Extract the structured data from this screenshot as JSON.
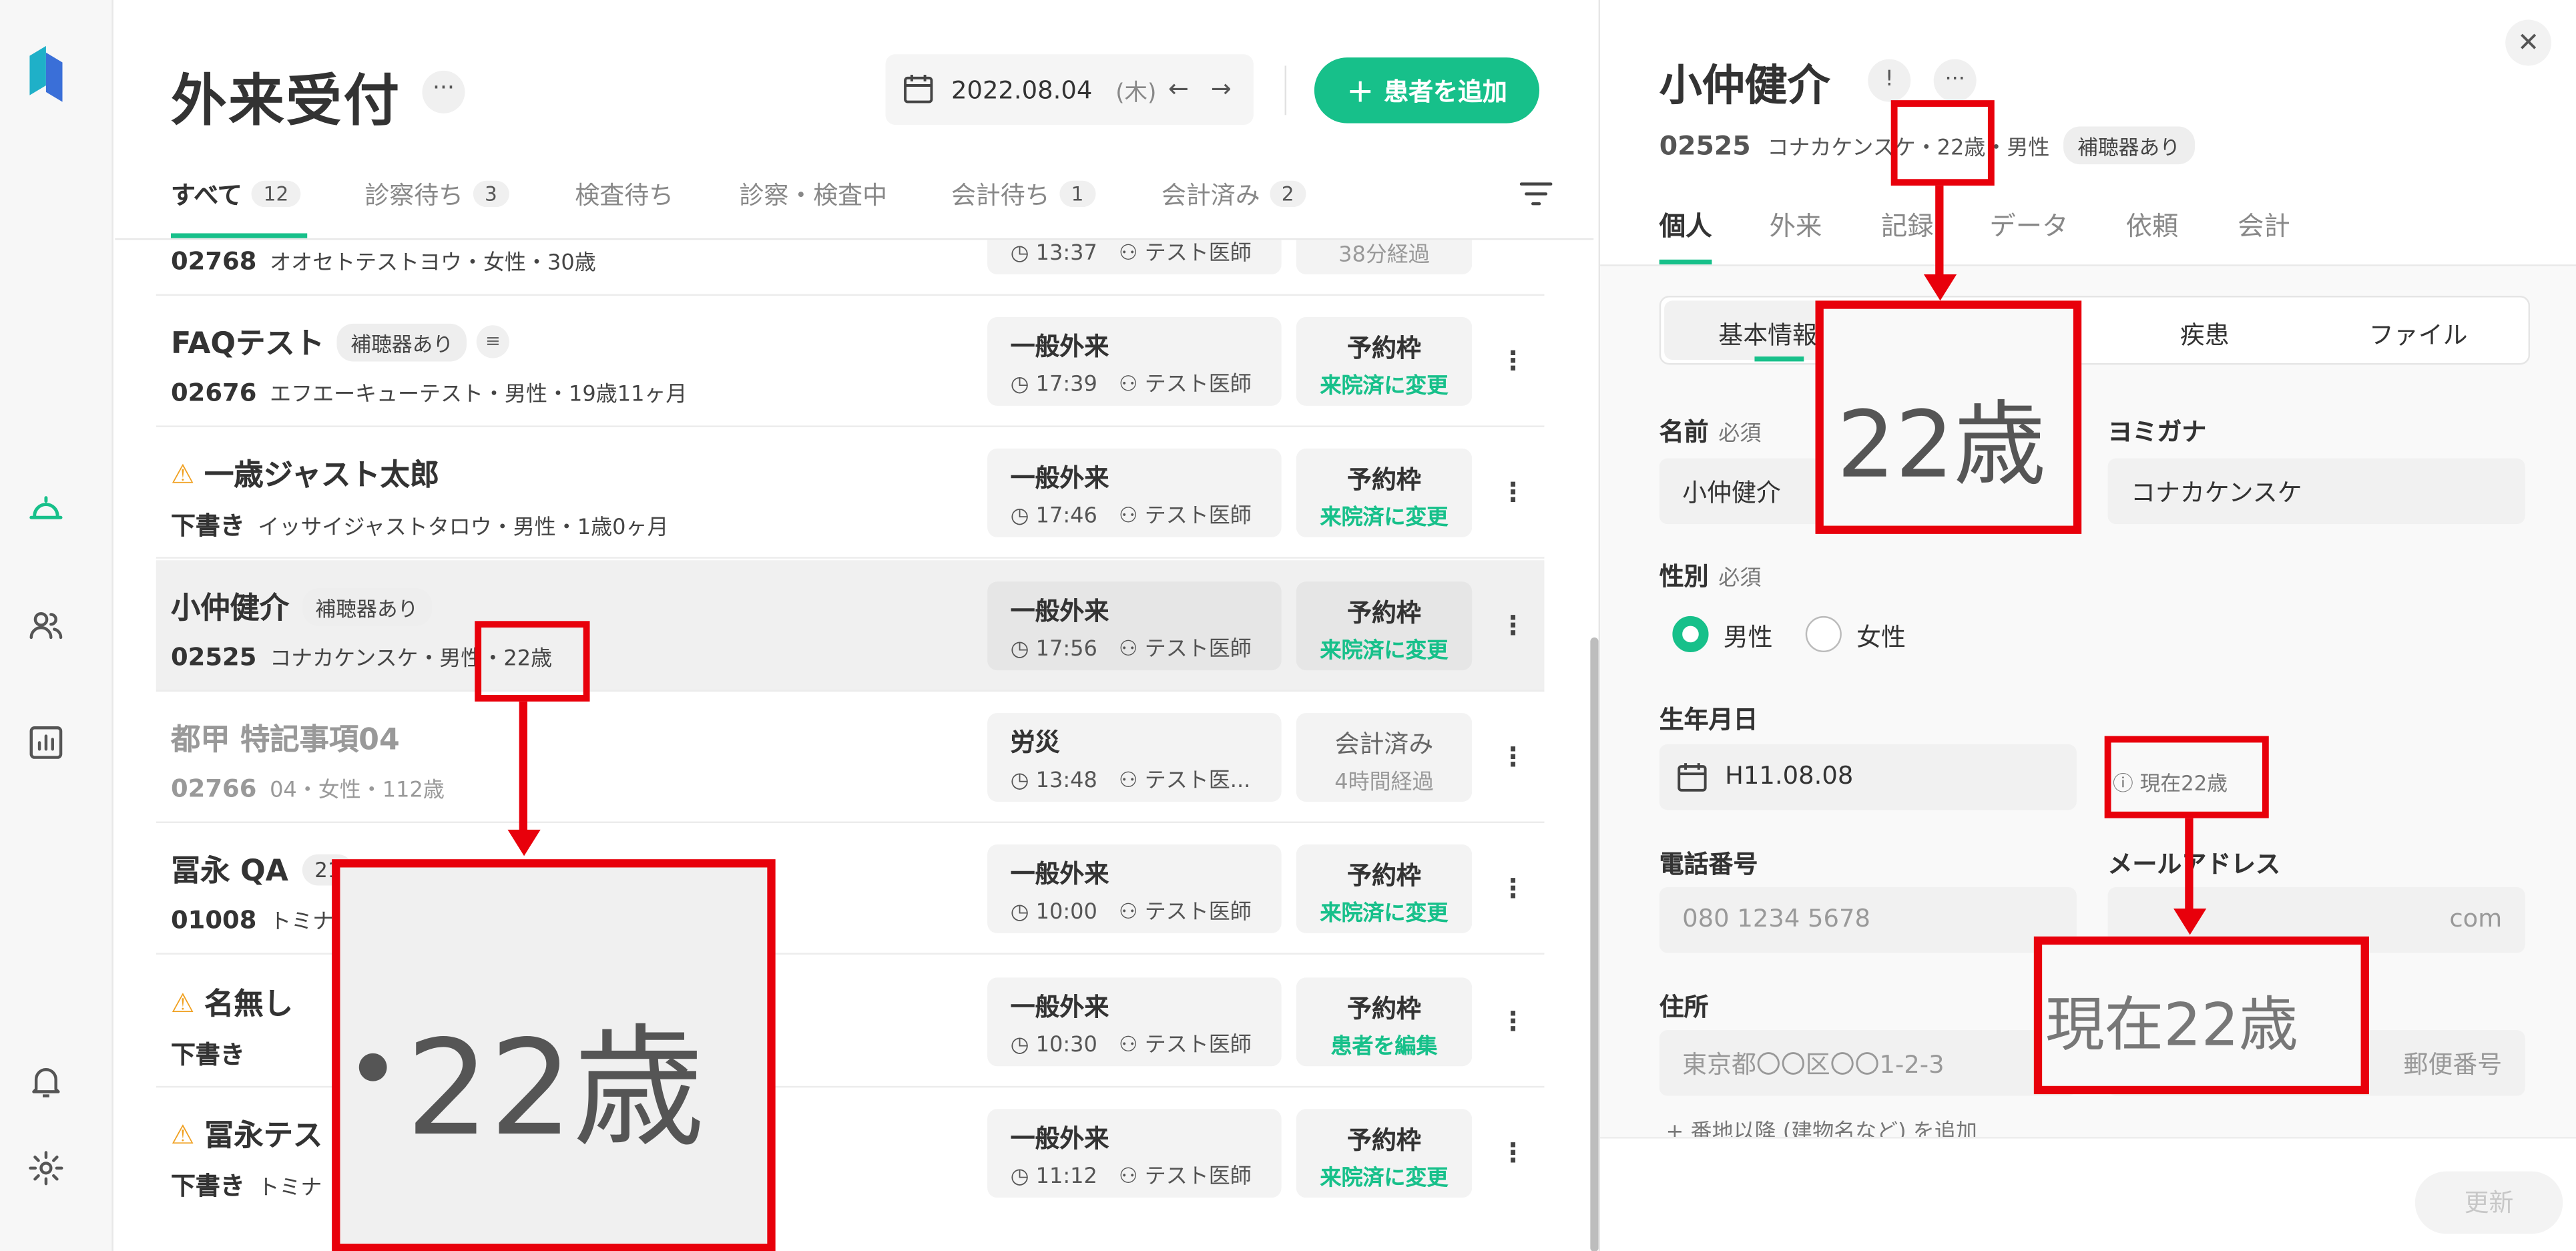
{
  "reception": {
    "title": "外来受付",
    "more_label": "···",
    "date": "2022.08.04",
    "weekday": "(木)",
    "prev_label": "←",
    "next_label": "→",
    "add_label": "患者を追加",
    "add_plus": "+",
    "tabs": [
      {
        "label": "すべて",
        "count": "12"
      },
      {
        "label": "診察待ち",
        "count": "3"
      },
      {
        "label": "検査待ち",
        "count": ""
      },
      {
        "label": "診察・検査中",
        "count": ""
      },
      {
        "label": "会計待ち",
        "count": "1"
      },
      {
        "label": "会計済み",
        "count": "2"
      }
    ],
    "rows": [
      {
        "name": "",
        "tag": "",
        "pid": "02768",
        "kana_info": "オオセトテストヨウ・女性・30歳",
        "visit_type": "",
        "time": "13:37",
        "doctor": "テスト医師",
        "status": "",
        "status_sub": "38分経過"
      },
      {
        "name": "FAQテスト",
        "tag": "補聴器あり",
        "pid": "02676",
        "kana_info": "エフエーキューテスト・男性・19歳11ヶ月",
        "visit_type": "一般外来",
        "time": "17:39",
        "doctor": "テスト医師",
        "status": "予約枠",
        "status_sub": "来院済に変更"
      },
      {
        "name": "一歳ジャスト太郎",
        "tag": "",
        "pid": "下書き",
        "kana_info": "イッサイジャストタロウ・男性・1歳0ヶ月",
        "visit_type": "一般外来",
        "time": "17:46",
        "doctor": "テスト医師",
        "status": "予約枠",
        "status_sub": "来院済に変更"
      },
      {
        "name": "小仲健介",
        "tag": "補聴器あり",
        "pid": "02525",
        "kana_info": "コナカケンスケ・男性・22歳",
        "visit_type": "一般外来",
        "time": "17:56",
        "doctor": "テスト医師",
        "status": "予約枠",
        "status_sub": "来院済に変更"
      },
      {
        "name": "都甲 特記事項04",
        "tag": "",
        "pid": "02766",
        "kana_info": "04・女性・112歳",
        "visit_type": "労災",
        "time": "13:48",
        "doctor": "テスト医...",
        "status": "会計済み",
        "status_sub": "4時間経過"
      },
      {
        "name": "冨永 QA",
        "tag": "21",
        "pid": "01008",
        "kana_info": "トミナ",
        "visit_type": "一般外来",
        "time": "10:00",
        "doctor": "テスト医師",
        "status": "予約枠",
        "status_sub": "来院済に変更"
      },
      {
        "name": "名無し",
        "tag": "",
        "pid": "下書き",
        "kana_info": "",
        "visit_type": "一般外来",
        "time": "10:30",
        "doctor": "テスト医師",
        "status": "予約枠",
        "status_sub": "患者を編集"
      },
      {
        "name": "冨永テス",
        "tag": "",
        "pid": "下書き",
        "kana_info": "トミナ",
        "visit_type": "一般外来",
        "time": "11:12",
        "doctor": "テスト医師",
        "status": "予約枠",
        "status_sub": "来院済に変更"
      }
    ]
  },
  "patient": {
    "name": "小仲健介",
    "pid": "02525",
    "kana_info": "コナカケンスケ・22歳・男性",
    "tag": "補聴器あり",
    "tabs": [
      "個人",
      "外来",
      "記録",
      "データ",
      "依頼",
      "会計"
    ],
    "subtabs": [
      "基本情報",
      "疾患",
      "ファイル"
    ],
    "form": {
      "name_label": "名前",
      "required": "必須",
      "name_value": "小仲健介",
      "kana_label": "ヨミガナ",
      "kana_value": "コナカケンスケ",
      "sex_label": "性別",
      "male": "男性",
      "female": "女性",
      "birth_label": "生年月日",
      "birth_value": "H11.08.08",
      "age_hint": "現在22歳",
      "phone_label": "電話番号",
      "phone_value": "080 1234 5678",
      "email_label": "メールアドレス",
      "email_value": "com",
      "address_label": "住所",
      "address_value": "東京都〇〇区〇〇1-2-3",
      "postal_value": "郵便番号",
      "add_address": "番地以降 (建物名など) を追加"
    },
    "update_label": "更新"
  },
  "annotations": {
    "zoom_left": "22歳",
    "zoom_left_dot": "・",
    "zoom_top": "22歳",
    "zoom_right": "現在22歳"
  },
  "colors": {
    "accent": "#17c08a",
    "annotation": "#e8000b",
    "warning": "#f0a020"
  }
}
